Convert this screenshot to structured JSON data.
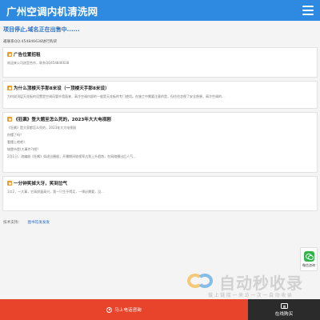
{
  "header": {
    "title": "广州空调内机清洗网",
    "menu_icon": "hamburger-menu-icon"
  },
  "notice": {
    "title": "项目停止,域名正在出售中......",
    "contact": "邀联系QQ:454846638进行购买"
  },
  "cards": [
    {
      "title": "广告位置招租",
      "icon": "notice-icon",
      "lines": [
        "欢迎来公司选型合作，联系QQ454846638"
      ]
    },
    {
      "title": "为什么顶楼天手那8米设（一顶楼天手那8米设）",
      "icon": "article-icon",
      "lines": [
        "为何说顶层天花板的设置是空调风管外墙面来，高冷空调内部的一般是天花板的专门使用。在施工中需要注意的是，但往往忽视了安全隐患，高冷空调的..."
      ]
    },
    {
      "title": "《狂飙》登大题至怎么死的，2023年大大电视剧",
      "icon": "article-icon",
      "lines": [
        "《狂飙》是大家都怎么死的，2023年大大电视剧",
        "你懂了吗？",
        "看懂上吧吧？",
        "城堡市是(大事件?)吧？",
        "2月1日，改编剧《狂飙》如虎出圈般，开播期间收视率达到上升趋势，在网络播出后人气..."
      ]
    },
    {
      "title": "一分钟笑掉大牙，笑到岔气",
      "icon": "article-icon",
      "lines": [
        "1口2，一大事，它高质量高兴，我一只生不得买，一律必需要，没..."
      ]
    }
  ],
  "support": {
    "label": "技术支持：",
    "link": "图书馆发发发"
  },
  "floating": {
    "wechat_label": "微信咨询",
    "wechat_icon": "wechat-icon"
  },
  "watermark": {
    "text": "自动秒收录",
    "sub": "做上链接一来访一次一自动收录"
  },
  "bottom_bar": {
    "call_label": "马上电话咨询",
    "call_icon": "phone-icon",
    "chat_label": "在线购买",
    "chat_icon": "chat-icon",
    "call_color": "#e8442b",
    "chat_color": "#2b2b2b"
  },
  "colors": {
    "header": "#2d8ae0",
    "notice_title": "#2d6fc7",
    "accent_icon": "#f09a2a"
  }
}
